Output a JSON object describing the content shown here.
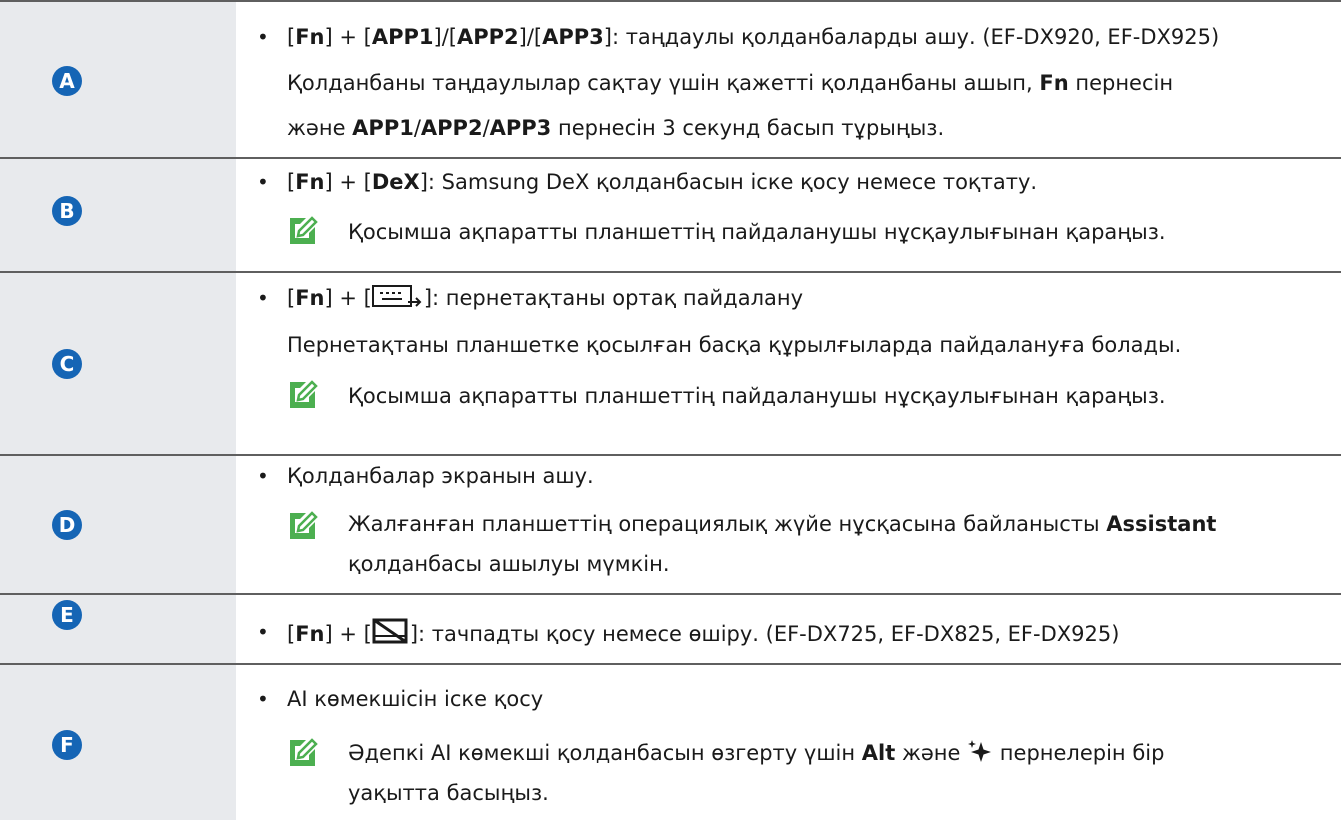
{
  "rows": {
    "a": {
      "badge": "A",
      "line1": {
        "pre": "[",
        "fn": "Fn",
        "mid1": "] + [",
        "k1": "APP1",
        "s1": "]/[",
        "k2": "APP2",
        "s2": "]/[",
        "k3": "APP3",
        "post": "]: таңдаулы қолданбаларды ашу. (EF-DX920, EF-DX925)"
      },
      "line2": {
        "pre": "Қолданбаны таңдаулылар сақтау үшін қажетті қолданбаны ашып, ",
        "fn": "Fn",
        "post": " пернесін"
      },
      "line3": {
        "pre": "және ",
        "k1": "APP1",
        "s1": "/",
        "k2": "APP2",
        "s2": "/",
        "k3": "APP3",
        "post": " пернесін 3 секунд басып тұрыңыз."
      }
    },
    "b": {
      "badge": "B",
      "line1": {
        "pre": "[",
        "fn": "Fn",
        "mid": "] + [",
        "key": "DeX",
        "post": "]: Samsung DeX қолданбасын іске қосу немесе тоқтату."
      },
      "note": "Қосымша ақпаратты планшеттің пайдаланушы нұсқаулығынан қараңыз."
    },
    "c": {
      "badge": "C",
      "line1": {
        "pre": "[",
        "fn": "Fn",
        "mid": "] + [",
        "post": "]: пернетақтаны ортақ пайдалану"
      },
      "line2": "Пернетақтаны планшетке қосылған басқа құрылғыларда пайдалануға болады.",
      "note": "Қосымша ақпаратты планшеттің пайдаланушы нұсқаулығынан қараңыз."
    },
    "d": {
      "badge": "D",
      "line1": "Қолданбалар экранын ашу.",
      "note1": {
        "pre": "Жалғанған планшеттің операциялық жүйе нұсқасына байланысты ",
        "bold": "Assistant"
      },
      "note2": "қолданбасы ашылуы мүмкін."
    },
    "e": {
      "badge": "E",
      "line1": {
        "pre": "[",
        "fn": "Fn",
        "mid": "] + [",
        "post": "]: тачпадты қосу немесе өшіру. (EF-DX725, EF-DX825, EF-DX925)"
      }
    },
    "f": {
      "badge": "F",
      "line1": "AI көмекшісін іске қосу",
      "note1": {
        "pre": "Әдепкі AI көмекші қолданбасын өзгерту үшін ",
        "bold": "Alt",
        "mid": " және ",
        "post": " пернелерін бір"
      },
      "note2": "уақытта басыңыз."
    }
  },
  "bullet_char": "•",
  "colors": {
    "badge": "#1565b5",
    "label_bg": "#e8eaed",
    "note_icon": "#4caf50",
    "divider": "#5f5f5f"
  },
  "icons": {
    "note": "note-pencil-icon",
    "share": "keyboard-share-icon",
    "touchpad": "touchpad-off-icon",
    "ai": "ai-sparkle-icon"
  }
}
